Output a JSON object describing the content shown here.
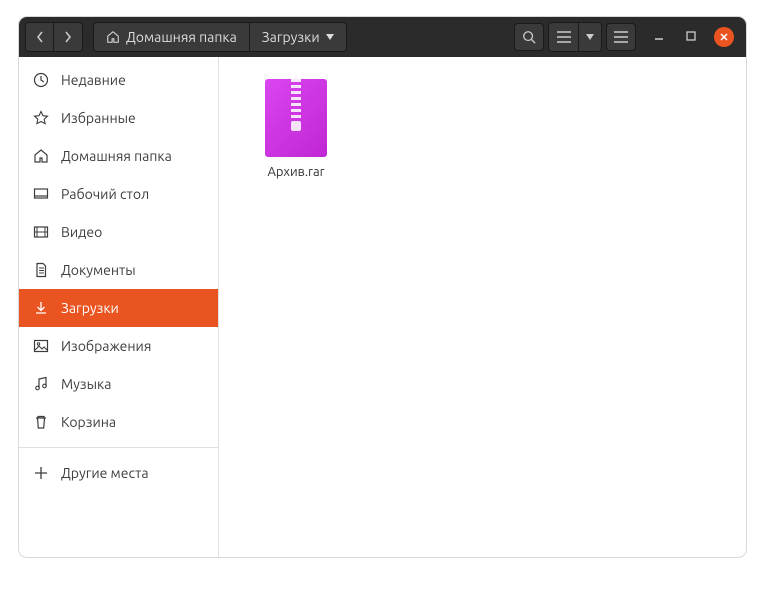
{
  "titlebar": {
    "path_home": "Домашняя папка",
    "path_current": "Загрузки"
  },
  "sidebar": {
    "items": [
      {
        "label": "Недавние",
        "icon": "recent"
      },
      {
        "label": "Избранные",
        "icon": "star"
      },
      {
        "label": "Домашняя папка",
        "icon": "home"
      },
      {
        "label": "Рабочий стол",
        "icon": "desktop"
      },
      {
        "label": "Видео",
        "icon": "video"
      },
      {
        "label": "Документы",
        "icon": "document"
      },
      {
        "label": "Загрузки",
        "icon": "download"
      },
      {
        "label": "Изображения",
        "icon": "image"
      },
      {
        "label": "Музыка",
        "icon": "music"
      },
      {
        "label": "Корзина",
        "icon": "trash"
      }
    ],
    "other_places": "Другие места",
    "active_index": 6
  },
  "content": {
    "files": [
      {
        "name": "Архив.rar",
        "type": "archive"
      }
    ]
  },
  "colors": {
    "accent": "#e95420"
  }
}
